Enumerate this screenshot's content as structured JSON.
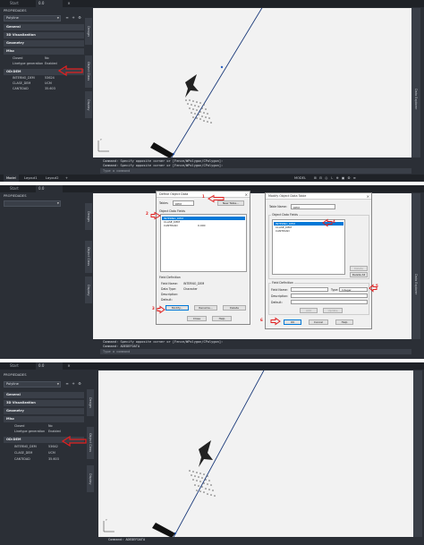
{
  "app": {
    "start_tab": "Start",
    "file_tab": "0.0",
    "palette_title": "PROPIEDADES",
    "selected_object": "Polyline"
  },
  "properties": {
    "categories": [
      "General",
      "3D Visualization",
      "Geometry",
      "Misc"
    ],
    "misc_rows": [
      {
        "name": "Closed",
        "value": "No"
      },
      {
        "name": "Linetype generation",
        "value": "Enabled"
      }
    ],
    "od_header": "OD:DEM",
    "od_rows": [
      {
        "name": "INTERNO_DEM",
        "value": "53624"
      },
      {
        "name": "CLASE_DEM",
        "value": "UCM"
      },
      {
        "name": "CANTIDAD",
        "value": "35.603"
      }
    ],
    "od_rows_after": [
      {
        "name": "INTERNO_DEM",
        "value": "53642"
      },
      {
        "name": "CLASE_DEM",
        "value": "UCM"
      },
      {
        "name": "CANTIDAD",
        "value": "35.603"
      }
    ]
  },
  "side_tabs": {
    "design": "Design",
    "object_class": "Object Class",
    "display": "Display",
    "data_explorer": "Data Explorer"
  },
  "command": {
    "history1": "Command: Specify opposite corner or [Fence/WPolygon/CPolygon]:",
    "history2": "Command: Specify opposite corner or [Fence/WPolygon/CPolygon]:",
    "history_p2_2": "Command: ADEDEFDATA",
    "input_placeholder": "Type a command",
    "history_p3": "Command: ADEDEFDATA"
  },
  "status": {
    "model_tab": "Model",
    "layout1": "Layout1",
    "layout2": "Layout2",
    "plus": "+",
    "model_label": "MODEL"
  },
  "define_dialog": {
    "title": "Define Object Data",
    "tables_label": "Tables",
    "table_value": "DEM",
    "new_table_button": "New Table...",
    "fields_label": "Object Data Fields",
    "fields": [
      "INTERNO_DEM",
      "CLASE_DEM",
      "CANTIDAD"
    ],
    "field_default_col": "0.000",
    "field_def_label": "Field Definition",
    "field_name_label": "Field Name:",
    "field_name_value": "INTERNO_DEM",
    "data_type_label": "Data Type:",
    "data_type_value": "Character",
    "description_label": "Description:",
    "default_label": "Default:",
    "modify_button": "Modify...",
    "rename_button": "Rename...",
    "delete_button": "Delete",
    "close_button": "Close",
    "help_button": "Help"
  },
  "modify_dialog": {
    "title": "Modify Object Data Table",
    "table_name_label": "Table Name:",
    "table_name_value": "DEM",
    "fields_label": "Object Data Fields",
    "fields": [
      "INTERNO_DEM",
      "CLASE_DEM",
      "CANTIDAD"
    ],
    "delete_button": "Delete",
    "delete_all_button": "Delete All",
    "field_def_label": "Field Definition",
    "field_name_label": "Field Name:",
    "type_label": "Type:",
    "type_value": "Integer",
    "description_label": "Description:",
    "default_label": "Default:",
    "add_button": "Add",
    "update_button": "Update",
    "ok_button": "OK",
    "cancel_button": "Cancel",
    "help_button": "Help"
  },
  "callouts": [
    "1",
    "2",
    "3",
    "4",
    "5",
    "6"
  ],
  "colors": {
    "ui_dark": "#2b2f36",
    "canvas": "#f2f2f2",
    "annotation_red": "#e02020",
    "selection_blue": "#0078d7"
  }
}
